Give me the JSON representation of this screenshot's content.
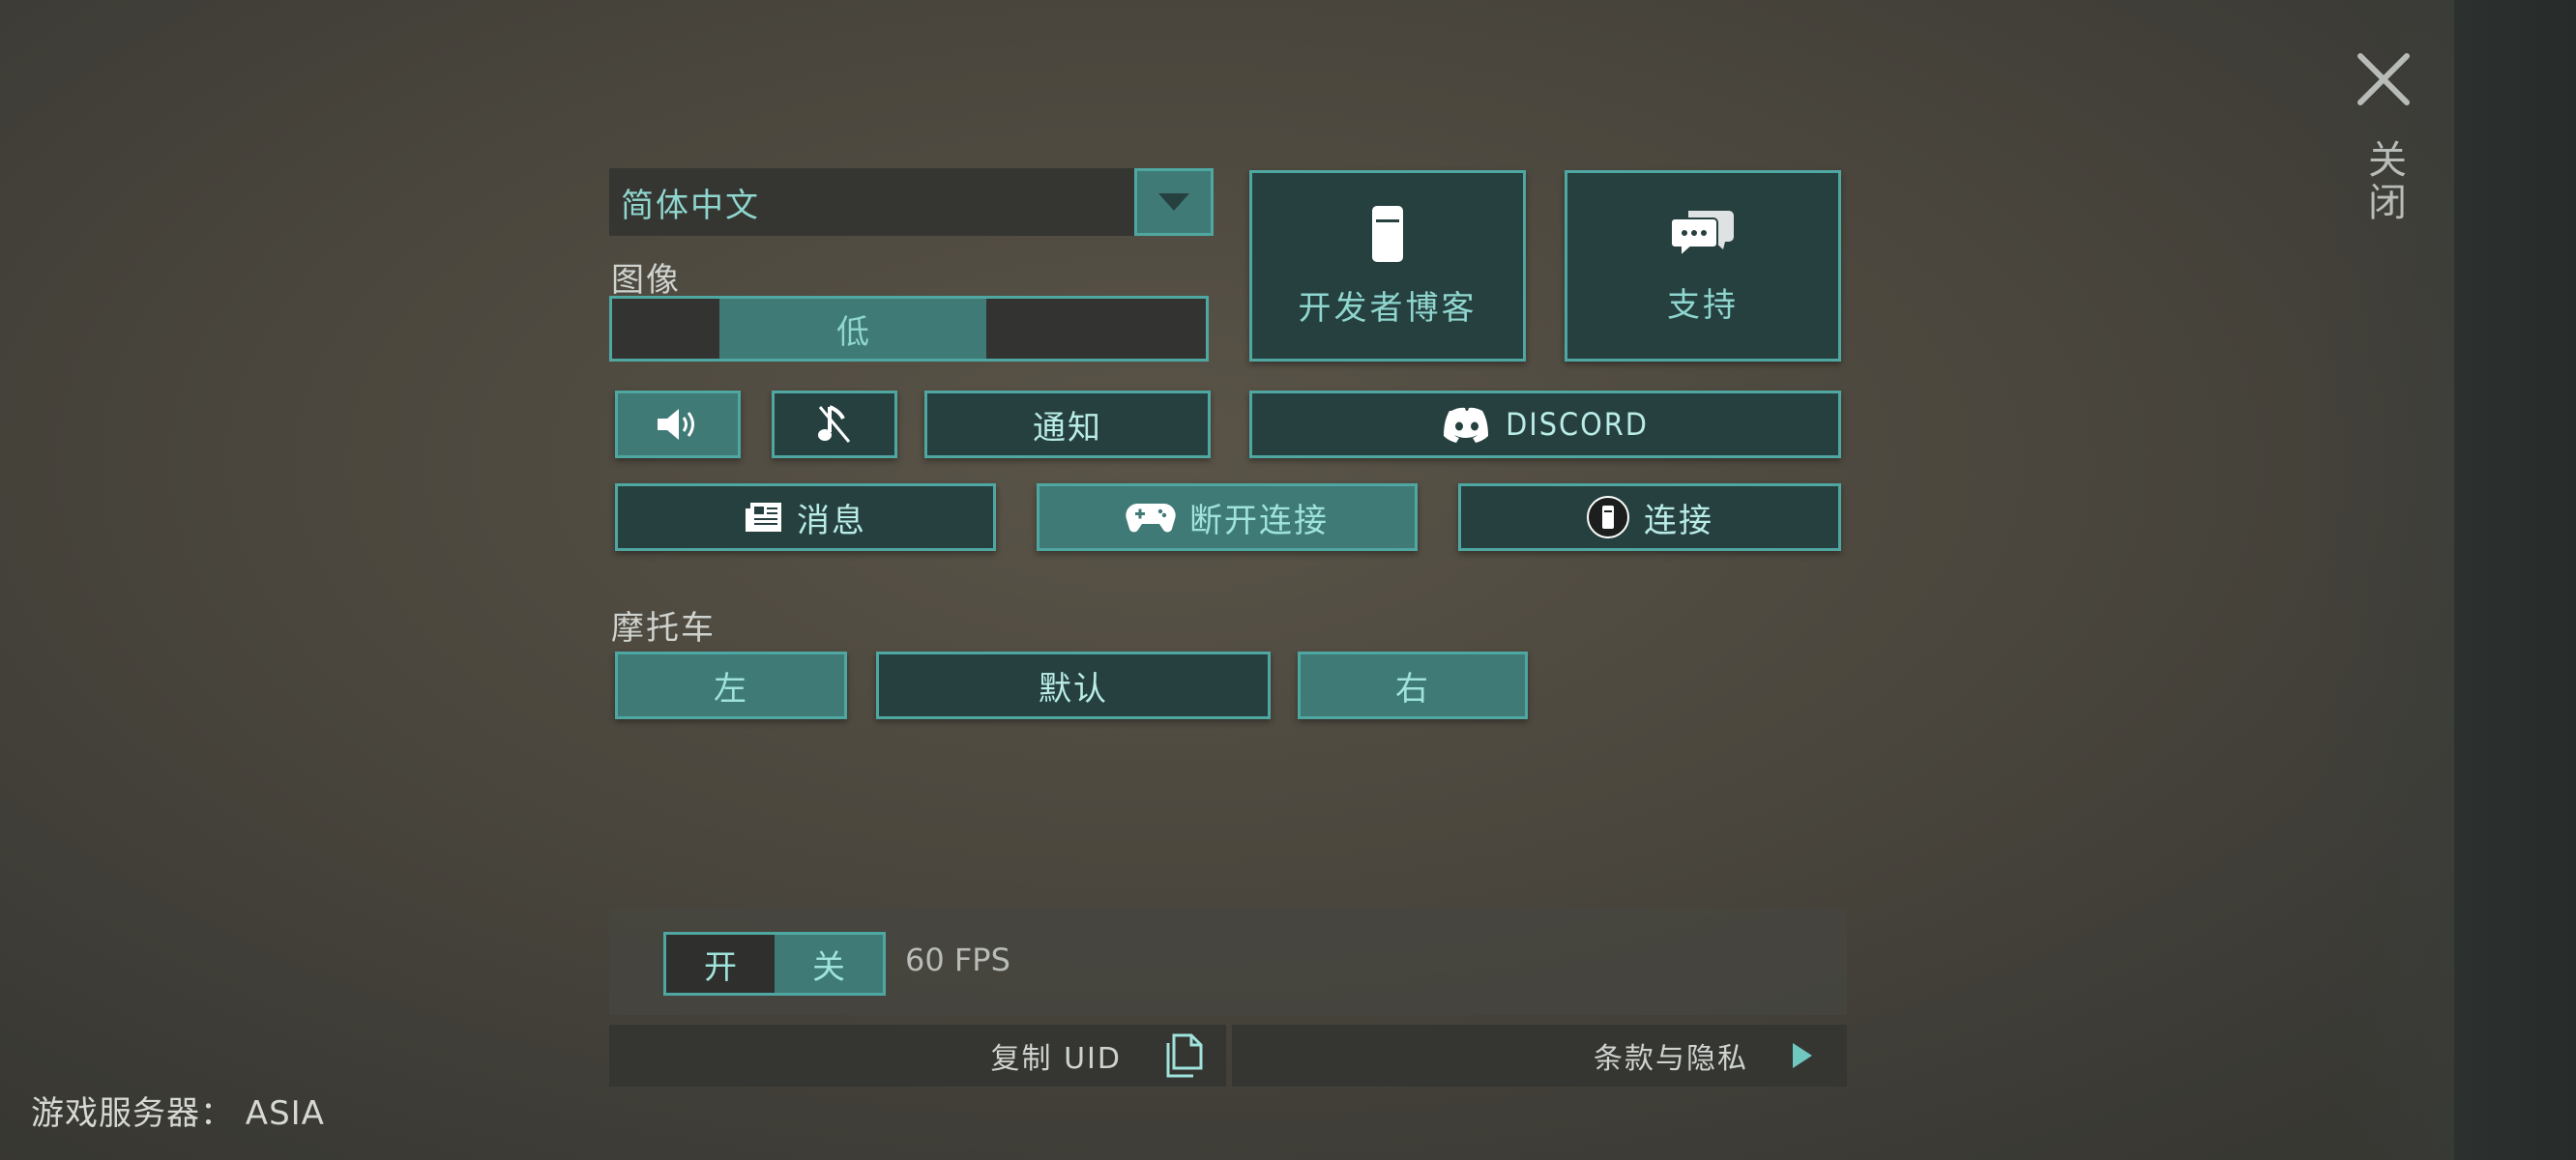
{
  "close": {
    "label": "关闭"
  },
  "language": {
    "selected": "简体中文"
  },
  "graphics": {
    "label": "图像",
    "level": "低",
    "level_fraction_start": 0.18,
    "level_fraction_end": 0.63
  },
  "tiles": {
    "dev_blog": "开发者博客",
    "support": "支持"
  },
  "buttons": {
    "notifications": "通知",
    "discord": "DISCORD",
    "news": "消息",
    "disconnect": "断开连接",
    "connect": "连接"
  },
  "motorcycle": {
    "label": "摩托车",
    "left": "左",
    "default": "默认",
    "right": "右"
  },
  "fps": {
    "on": "开",
    "off": "关",
    "value": "60 FPS",
    "selected": "关"
  },
  "footer": {
    "copy_uid": "复制 UID",
    "terms": "条款与隐私",
    "server": "游戏服务器：  ASIA"
  },
  "colors": {
    "accent": "#4fa7a2",
    "button_fill": "#3f7a76",
    "button_dark": "#26403f",
    "text_teal": "#8fd6cf"
  }
}
